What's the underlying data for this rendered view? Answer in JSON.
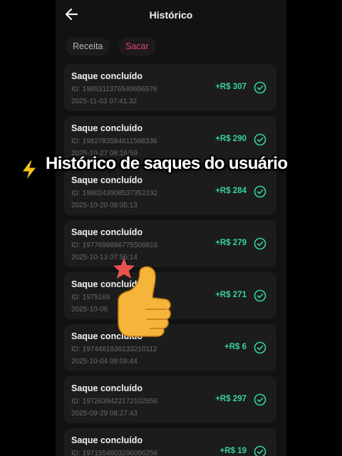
{
  "header": {
    "title": "Histórico",
    "back_icon": "arrow-left-icon"
  },
  "tabs": [
    {
      "label": "Receita",
      "active": false
    },
    {
      "label": "Sacar",
      "active": true
    }
  ],
  "withdrawals": [
    {
      "status": "Saque concluído",
      "id_label": "ID: 1985311376540696576",
      "datetime": "2025-11-03 07:41:32",
      "amount": "+R$ 307"
    },
    {
      "status": "Saque concluído",
      "id_label": "ID: 1982783584611598336",
      "datetime": "2025-10-27 08:16:59",
      "amount": "+R$ 290"
    },
    {
      "status": "Saque concluído",
      "id_label": "ID: 1980243908537352192",
      "datetime": "2025-10-20 08:05:13",
      "amount": "+R$ 284"
    },
    {
      "status": "Saque concluído",
      "id_label": "ID: 1977699896775506816",
      "datetime": "2025-10-13 07:56:14",
      "amount": "+R$ 279"
    },
    {
      "status": "Saque concluído",
      "id_label": "ID: 1975169",
      "datetime": "2025-10-06",
      "amount": "+R$ 271"
    },
    {
      "status": "Saque concluído",
      "id_label": "ID: 1974461936133210112",
      "datetime": "2025-10-04 09:09:44",
      "amount": "+R$ 6"
    },
    {
      "status": "Saque concluído",
      "id_label": "ID: 1972639422172102656",
      "datetime": "2025-09-29 08:27:43",
      "amount": "+R$ 297"
    },
    {
      "status": "Saque concluído",
      "id_label": "ID: 1971554603296096256",
      "datetime": "",
      "amount": "+R$ 19"
    }
  ],
  "overlay": {
    "caption": "Histórico de saques do usuário",
    "caption_icon": "lightning-bolt-icon",
    "sticker_icon": "thumbs-up-icon"
  },
  "colors": {
    "background": "#121212",
    "card": "#1c1c1c",
    "accent": "#e0407a",
    "amount": "#37d39a"
  }
}
